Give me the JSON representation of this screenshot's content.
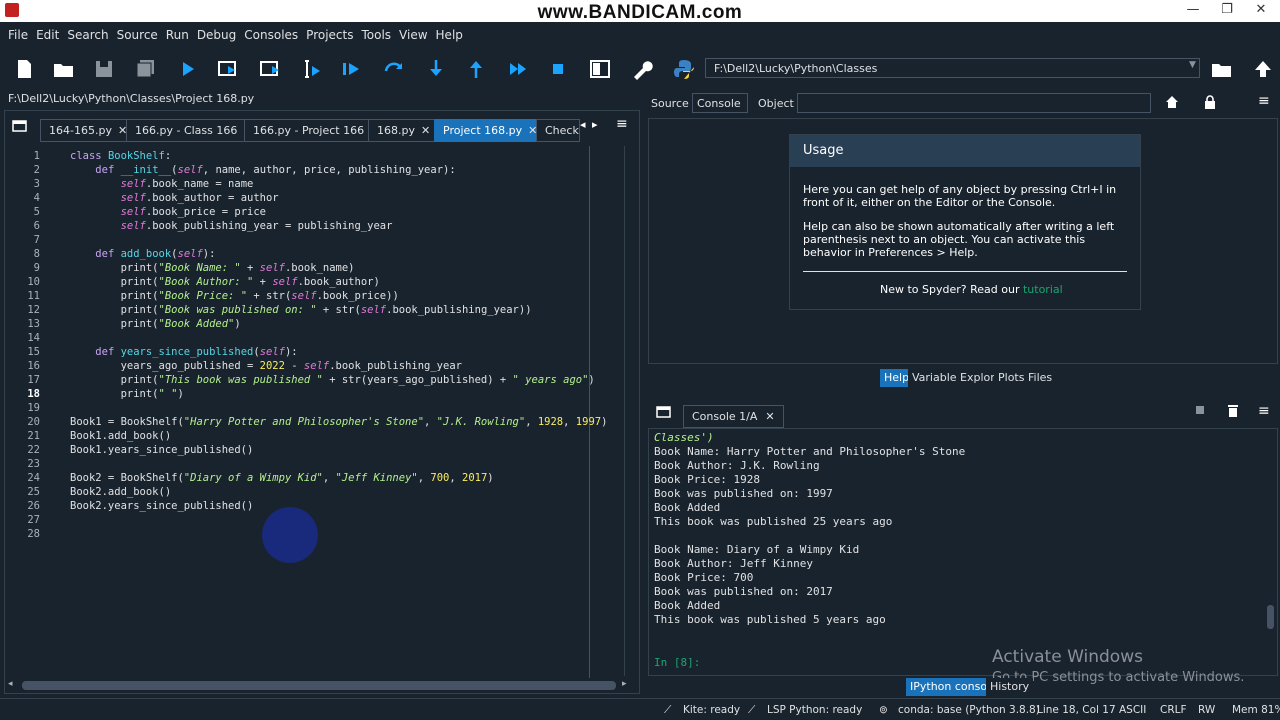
{
  "window": {
    "watermark": "www.BANDICAM.com",
    "minimize": "—",
    "restore": "❐",
    "close": "✕"
  },
  "menu": [
    "File",
    "Edit",
    "Search",
    "Source",
    "Run",
    "Debug",
    "Consoles",
    "Projects",
    "Tools",
    "View",
    "Help"
  ],
  "toolbar": {
    "working_dir": "F:\\Dell2\\Lucky\\Python\\Classes"
  },
  "editor": {
    "file_path": "F:\\Dell2\\Lucky\\Python\\Classes\\Project 168.py",
    "tabs": [
      {
        "label": "164-165.py",
        "active": false
      },
      {
        "label": "166.py - Class 166",
        "active": false
      },
      {
        "label": "166.py - Project 166",
        "active": false
      },
      {
        "label": "168.py",
        "active": false
      },
      {
        "label": "Project 168.py",
        "active": true
      },
      {
        "label": "Check.p",
        "active": false
      }
    ],
    "current_line": 18
  },
  "help": {
    "source_label": "Source",
    "source_value": "Console",
    "object_label": "Object",
    "title": "Usage",
    "p1": "Here you can get help of any object by pressing Ctrl+I in front of it, either on the Editor or the Console.",
    "p2": "Help can also be shown automatically after writing a left parenthesis next to an object. You can activate this behavior in Preferences > Help.",
    "p3_prefix": "New to Spyder? Read our ",
    "p3_link": "tutorial",
    "tabs": [
      "Help",
      "Variable Explorer",
      "Plots",
      "Files"
    ]
  },
  "console": {
    "tab_label": "Console 1/A",
    "output": [
      "Classes')",
      "Book Name: Harry Potter and Philosopher's Stone",
      "Book Author: J.K. Rowling",
      "Book Price: 1928",
      "Book was published on: 1997",
      "Book Added",
      "This book was published 25 years ago",
      "",
      "Book Name: Diary of a Wimpy Kid",
      "Book Author: Jeff Kinney",
      "Book Price: 700",
      "Book was published on: 2017",
      "Book Added",
      "This book was published 5 years ago"
    ],
    "prompt": "In [8]:",
    "bottom_tabs": [
      "IPython console",
      "History"
    ],
    "activate_title": "Activate Windows",
    "activate_sub": "Go to PC settings to activate Windows."
  },
  "status": {
    "kite": "Kite: ready",
    "lsp": "LSP Python: ready",
    "conda": "conda: base (Python 3.8.8)",
    "position": "Line 18, Col 17",
    "encoding": "ASCII",
    "eol": "CRLF",
    "mode": "RW",
    "mem": "Mem 81%"
  },
  "colors": {
    "accent": "#1a72bb",
    "background": "#19232d",
    "keyword": "#c8a4f5",
    "string": "#b4f08e",
    "self": "#e27ad8",
    "number": "#faed5c",
    "function": "#57d6e4"
  }
}
